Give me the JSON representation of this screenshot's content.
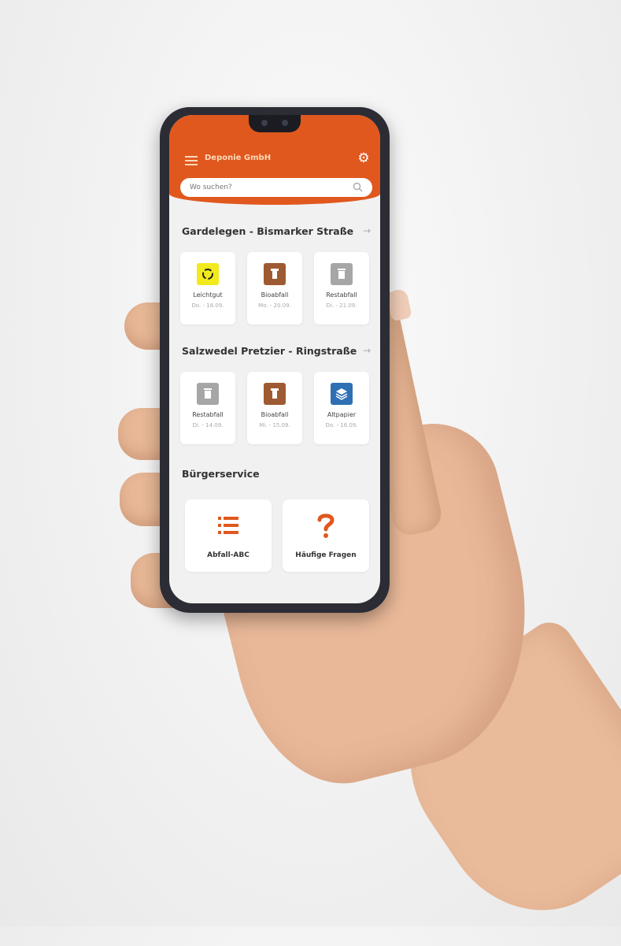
{
  "app": {
    "title": "Deponie GmbH",
    "search_placeholder": "Wo suchen?"
  },
  "locations": [
    {
      "name": "Gardelegen - Bismarker Straße",
      "items": [
        {
          "label": "Leichtgut",
          "date": "Do. - 18.09.",
          "icon": "recycle-icon",
          "color": "#f2ea1c"
        },
        {
          "label": "Bioabfall",
          "date": "Mo. - 20.09.",
          "icon": "bio-bin-icon",
          "color": "#9e5a32"
        },
        {
          "label": "Restabfall",
          "date": "Di. - 21.09.",
          "icon": "trash-bin-icon",
          "color": "#a6a6a6"
        }
      ]
    },
    {
      "name": "Salzwedel  Pretzier - Ringstraße",
      "items": [
        {
          "label": "Restabfall",
          "date": "Di. - 14.09.",
          "icon": "trash-bin-icon",
          "color": "#a6a6a6"
        },
        {
          "label": "Bioabfall",
          "date": "Mi. - 15.09.",
          "icon": "bio-bin-icon",
          "color": "#9e5a32"
        },
        {
          "label": "Altpapier",
          "date": "Do. - 16.09.",
          "icon": "paper-stack-icon",
          "color": "#2f6fb4"
        }
      ]
    }
  ],
  "service": {
    "title": "Bürgerservice",
    "tiles": [
      {
        "label": "Abfall-ABC",
        "icon": "list-icon"
      },
      {
        "label": "Häufige Fragen",
        "icon": "question-icon"
      }
    ]
  },
  "colors": {
    "accent": "#e0581e",
    "header_text": "#ffd9b8"
  }
}
